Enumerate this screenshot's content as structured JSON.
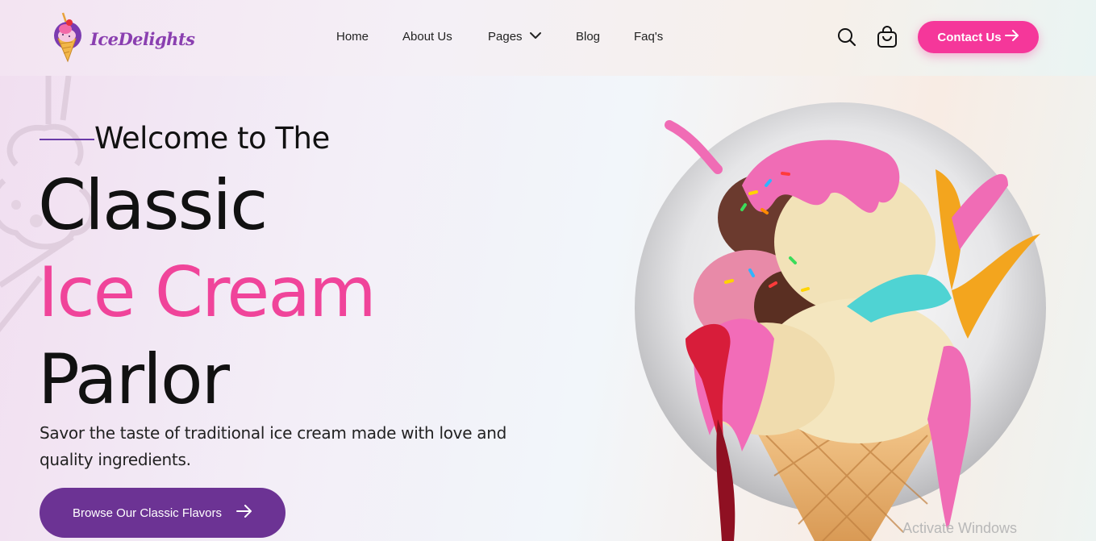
{
  "brand": {
    "logo_text": "IceDelights",
    "logo_icon": "ice-cream-cone-logo"
  },
  "nav": {
    "items": [
      {
        "label": "Home"
      },
      {
        "label": "About Us"
      },
      {
        "label": "Pages",
        "icon": "chevron-down-icon"
      },
      {
        "label": "Blog"
      },
      {
        "label": "Faq's"
      }
    ]
  },
  "header_actions": {
    "search_icon": "search-icon",
    "cart_icon": "shopping-bag-icon",
    "contact_label": "Contact Us",
    "contact_icon": "arrow-right-icon"
  },
  "hero": {
    "welcome": "Welcome to The",
    "line1": "Classic",
    "line2": "Ice Cream",
    "line3": "Parlor",
    "description": "Savor the taste of traditional ice cream made with love and quality ingredients.",
    "cta_label": "Browse Our Classic Flavors",
    "cta_icon": "arrow-right-icon",
    "image": "ice-cream-cone-image"
  },
  "watermark": "Activate Windows",
  "colors": {
    "accent_pink": "#f5379a",
    "headline_pink": "#f0449a",
    "primary_purple": "#6c3394",
    "logo_purple": "#8a3fb0"
  }
}
